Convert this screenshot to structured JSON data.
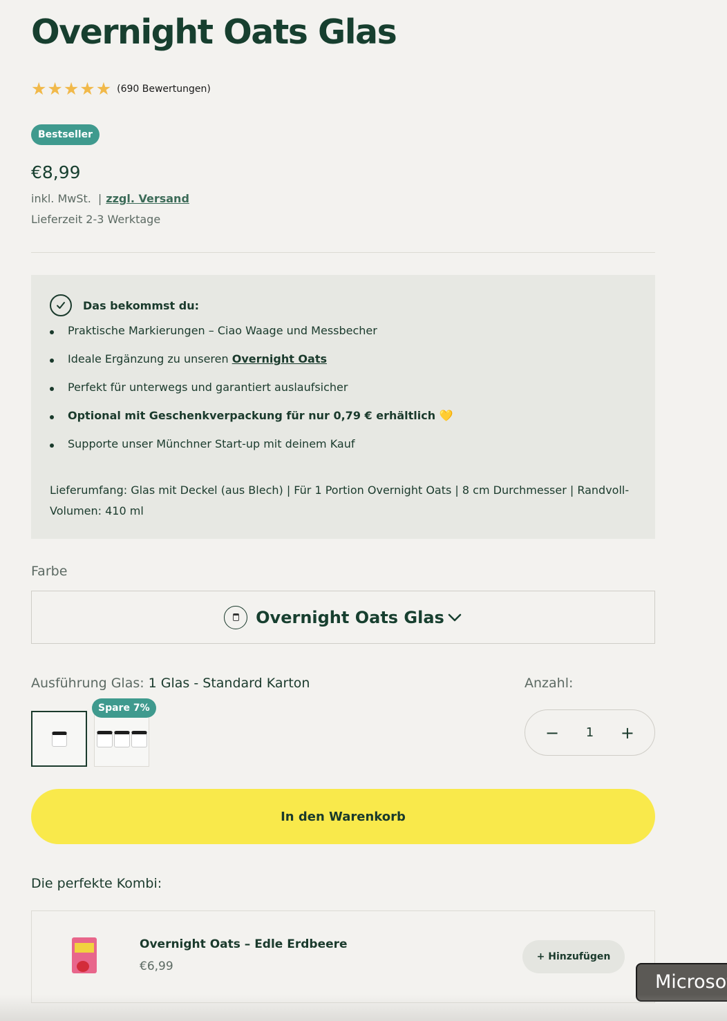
{
  "product": {
    "title": "Overnight Oats Glas",
    "rating_count": "(690 Bewertungen)",
    "rating": 5,
    "badge": "Bestseller",
    "price": "€8,99",
    "tax_label": "inkl. MwSt.",
    "tax_sep": "|",
    "shipping_link": "zzgl. Versand",
    "delivery": "Lieferzeit 2-3 Werktage"
  },
  "info": {
    "title": "Das bekommst du:",
    "bullet_1": "Praktische Markierungen – Ciao Waage und Messbecher",
    "bullet_2_prefix": "Ideale Ergänzung zu unseren ",
    "bullet_2_link": "Overnight Oats",
    "bullet_3": "Perfekt für unterwegs und garantiert auslaufsicher",
    "bullet_4": "Optional mit Geschenkverpackung für nur 0,79 € erhältlich",
    "bullet_4_emoji": "💛",
    "bullet_5": "Supporte unser Münchner Start-up mit deinem Kauf",
    "scope": "Lieferumfang: Glas mit Deckel (aus Blech) | Für 1 Portion Overnight Oats | 8 cm Durchmesser | Randvoll-Volumen: 410 ml"
  },
  "variant": {
    "color_label": "Farbe",
    "color_value": "Overnight Oats Glas",
    "option_label": "Ausführung Glas:",
    "option_value": "1 Glas - Standard Karton",
    "save_badge": "Spare 7%"
  },
  "quantity": {
    "label": "Anzahl:",
    "minus": "−",
    "value": "1",
    "plus": "+"
  },
  "cart_button": "In den Warenkorb",
  "kombi": {
    "label": "Die perfekte Kombi:",
    "name": "Overnight Oats – Edle Erdbeere",
    "price": "€6,99",
    "add_button": "+ Hinzufügen"
  },
  "toast": "Microsoft",
  "colors": {
    "primary": "#173f2f",
    "badge": "#3f9a8e",
    "cart": "#f9e94b",
    "star": "#f1b94a"
  }
}
